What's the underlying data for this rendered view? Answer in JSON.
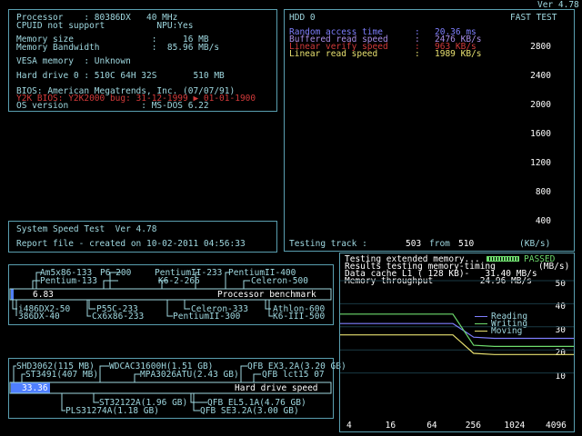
{
  "header": {
    "version": "Ver 4.78"
  },
  "sysinfo": {
    "l1": "Processor    : 80386DX   40 MHz",
    "l2": "CPUID not support          NPU:Yes",
    "l3": "Memory size               :     16 MB",
    "l4": "Memory Bandwidth          :  85.96 MB/s",
    "l5": "VESA memory  : Unknown",
    "l6": "Hard drive 0 : 510C 64H 32S       510 MB",
    "l7": "BIOS: American Megatrends, Inc. (07/07/91)",
    "l8": "Y2K BIOS: Y2K2000 bug: 31-12-1999 ▶ 01-01-1900",
    "l9": "OS version              : MS-DOS 6.22"
  },
  "speedtest": {
    "title": "System Speed Test  Ver 4.78",
    "report": "Report file - created on 10-02-2011 04:56:33"
  },
  "hdd": {
    "title": "HDD 0",
    "mode": "FAST TEST",
    "stats": [
      {
        "label": "Random access time",
        "value": "20.36 ms",
        "color": "#7f7fff"
      },
      {
        "label": "Buffered read speed",
        "value": "2476 KB/s",
        "color": "#a98ee8"
      },
      {
        "label": "Linear verify speed",
        "value": "963 KB/s",
        "color": "#d23a3a"
      },
      {
        "label": "Linear read speed",
        "value": "1989 KB/s",
        "color": "#e8e070"
      }
    ],
    "yticks": [
      "2800",
      "2400",
      "2000",
      "1600",
      "1200",
      "800",
      "400"
    ],
    "status_label": "Testing track :",
    "track": "503",
    "from_label": "from",
    "total": "510",
    "unit": "(KB/s)"
  },
  "cpu_bench": {
    "value": "6.83",
    "title": "Processor benchmark",
    "top_labels": [
      "Am5x86-133",
      "P6-200",
      "PentiumII-233",
      "PentiumII-400",
      "Pentium-133",
      "K6-2-266",
      "Celeron-500"
    ],
    "bottom_labels": [
      "i486DX2-50",
      "P55C-233",
      "Celeron-333",
      "Athlon-600",
      "386DX-40",
      "Cx6x86-233",
      "PentiumII-300",
      "K6-III-500"
    ]
  },
  "hdd_bench": {
    "value": "33.36",
    "title": "Hard drive speed",
    "top_labels": [
      "SHD3062(115 MB)",
      "WDCAC31600H(1.51 GB)",
      "QFB EX3.2A(3.20 GB)",
      "ST3491(407 MB)",
      "MPA3026ATU(2.43 GB)",
      "QFB lct15 07"
    ],
    "bottom_labels": [
      "ST32122A(1.96 GB)",
      "QFB EL5.1A(4.76 GB)",
      "PLS31274A(1.18 GB)",
      "QFB SE3.2A(3.00 GB)"
    ]
  },
  "memtest": {
    "line1": "Testing extended memory...",
    "passed": "PASSED",
    "line2": "Results testing memory-timing",
    "unit": "(MB/s)",
    "line3": "Data cache L1 ( 128 KB)-   31.40 MB/s",
    "line4": "Memory throughput     -   24.96 MB/s",
    "legend": [
      {
        "label": "Reading",
        "color": "#7f7fff"
      },
      {
        "label": "Writing",
        "color": "#6edc6e"
      },
      {
        "label": "Moving",
        "color": "#e8e070"
      }
    ],
    "yticks": [
      "50",
      "40",
      "30",
      "20",
      "10"
    ],
    "xticks": [
      "4",
      "16",
      "64",
      "256",
      "1024",
      "4096"
    ]
  },
  "chart_data": [
    {
      "type": "line",
      "title": "HDD 0",
      "ylabel": "(KB/s)",
      "ylim": [
        0,
        3000
      ],
      "series": [],
      "note": "graph area empty in screenshot"
    },
    {
      "type": "line",
      "ylabel": "(MB/s)",
      "ylim": [
        0,
        50
      ],
      "x": [
        4,
        16,
        64,
        128,
        256,
        512,
        1024,
        4096
      ],
      "series": [
        {
          "name": "Reading",
          "values": [
            31.4,
            31.4,
            31.4,
            31.4,
            25.5,
            25.0,
            25.0,
            25.0
          ]
        },
        {
          "name": "Writing",
          "values": [
            35.5,
            35.5,
            35.5,
            35.5,
            22.0,
            21.5,
            21.5,
            21.5
          ]
        },
        {
          "name": "Moving",
          "values": [
            26.5,
            26.5,
            26.5,
            26.5,
            18.5,
            18.0,
            18.0,
            18.0
          ]
        }
      ]
    }
  ]
}
